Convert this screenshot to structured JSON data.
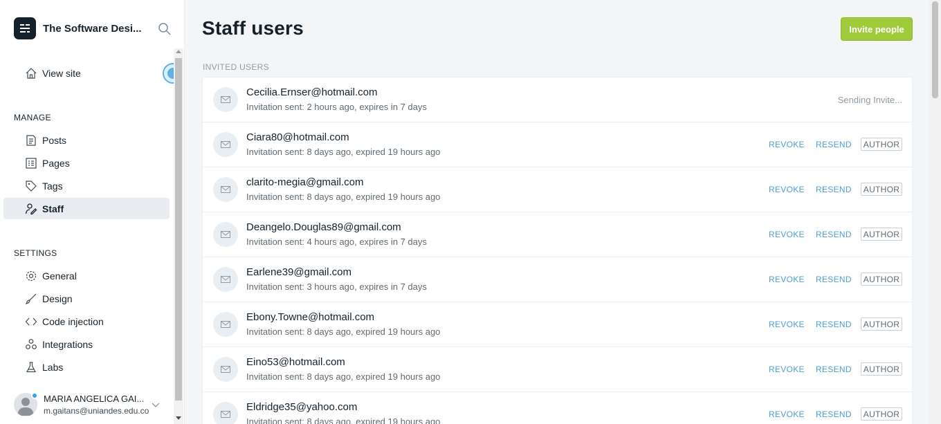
{
  "sidebar": {
    "brand_title": "The Software Desi...",
    "view_site": "View site",
    "manage_title": "MANAGE",
    "manage_items": [
      {
        "label": "Posts",
        "icon": "posts-icon"
      },
      {
        "label": "Pages",
        "icon": "pages-icon"
      },
      {
        "label": "Tags",
        "icon": "tag-icon"
      },
      {
        "label": "Staff",
        "icon": "staff-icon",
        "active": true
      }
    ],
    "settings_title": "SETTINGS",
    "settings_items": [
      {
        "label": "General",
        "icon": "gear-icon"
      },
      {
        "label": "Design",
        "icon": "brush-icon"
      },
      {
        "label": "Code injection",
        "icon": "code-icon"
      },
      {
        "label": "Integrations",
        "icon": "integrations-icon"
      },
      {
        "label": "Labs",
        "icon": "flask-icon"
      }
    ],
    "user": {
      "name": "MARIA ANGELICA GAI...",
      "email": "m.gaitans@uniandes.edu.co"
    }
  },
  "main": {
    "title": "Staff users",
    "invite_button": "Invite people",
    "invited_heading": "INVITED USERS",
    "actions": {
      "revoke": "REVOKE",
      "resend": "RESEND"
    },
    "invites": [
      {
        "email": "Cecilia.Ernser@hotmail.com",
        "meta": "Invitation sent: 2 hours ago, expires in 7 days",
        "status": "Sending Invite..."
      },
      {
        "email": "Ciara80@hotmail.com",
        "meta": "Invitation sent: 8 days ago, expired 19 hours ago",
        "role": "AUTHOR"
      },
      {
        "email": "clarito-megia@gmail.com",
        "meta": "Invitation sent: 8 days ago, expired 19 hours ago",
        "role": "AUTHOR"
      },
      {
        "email": "Deangelo.Douglas89@gmail.com",
        "meta": "Invitation sent: 4 hours ago, expires in 7 days",
        "role": "AUTHOR"
      },
      {
        "email": "Earlene39@gmail.com",
        "meta": "Invitation sent: 3 hours ago, expires in 7 days",
        "role": "AUTHOR"
      },
      {
        "email": "Ebony.Towne@hotmail.com",
        "meta": "Invitation sent: 8 days ago, expired 19 hours ago",
        "role": "AUTHOR"
      },
      {
        "email": "Eino53@hotmail.com",
        "meta": "Invitation sent: 8 days ago, expired 19 hours ago",
        "role": "AUTHOR"
      },
      {
        "email": "Eldridge35@yahoo.com",
        "meta": "Invitation sent: 8 days ago, expired 19 hours ago",
        "role": "AUTHOR"
      }
    ]
  },
  "colors": {
    "accent_green": "#9fcb3a",
    "link_blue": "#4b9fd5",
    "text_dark": "#15212a",
    "text_muted": "#5f6b73"
  }
}
